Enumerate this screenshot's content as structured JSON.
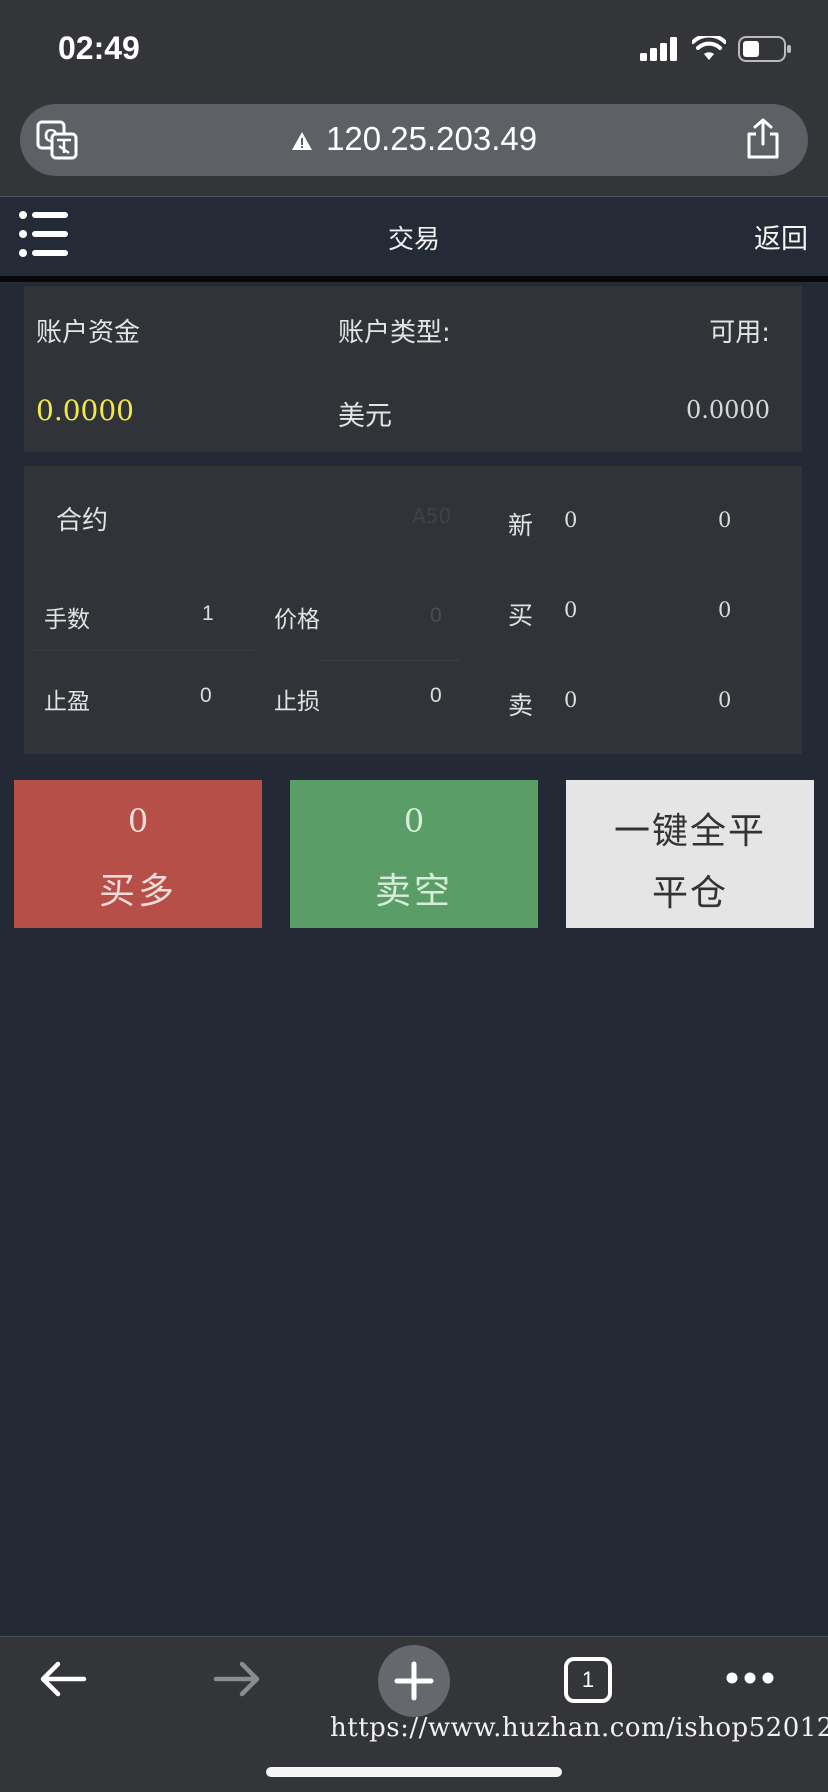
{
  "status_bar": {
    "time": "02:49"
  },
  "browser": {
    "url": "120.25.203.49",
    "watermark": "https://www.huzhan.com/ishop52012",
    "tab_count": "1"
  },
  "header": {
    "title": "交易",
    "back_label": "返回"
  },
  "account": {
    "funds_label": "账户资金",
    "funds_value": "0.0000",
    "type_label": "账户类型:",
    "type_value": "美元",
    "available_label": "可用:",
    "available_value": "0.0000"
  },
  "contract": {
    "contract_label": "合约",
    "contract_symbol": "A50",
    "lots_label": "手数",
    "lots_value": "1",
    "price_label": "价格",
    "price_value": "0",
    "take_profit_label": "止盈",
    "take_profit_value": "0",
    "stop_loss_label": "止损",
    "stop_loss_value": "0",
    "quotes": [
      {
        "label": "新",
        "value1": "0",
        "value2": "0"
      },
      {
        "label": "买",
        "value1": "0",
        "value2": "0"
      },
      {
        "label": "卖",
        "value1": "0",
        "value2": "0"
      }
    ]
  },
  "actions": {
    "buy_count": "0",
    "buy_label": "买多",
    "sell_count": "0",
    "sell_label": "卖空",
    "close_line1": "一键全平",
    "close_line2": "平仓"
  },
  "colors": {
    "buy": "#b64f47",
    "sell": "#5a9d66",
    "close": "#e5e5e5",
    "funds_value": "#f2e84a",
    "background": "#232a35"
  }
}
